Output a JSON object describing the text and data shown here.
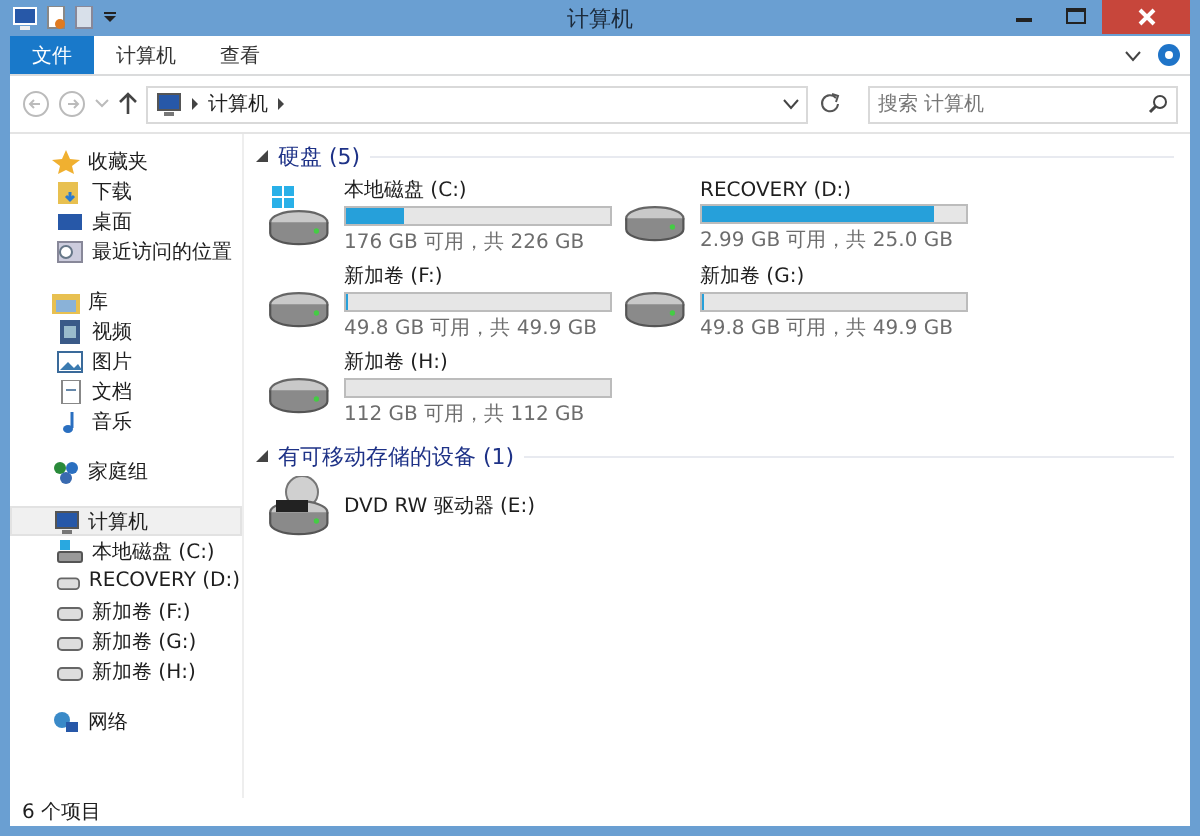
{
  "window": {
    "title": "计算机"
  },
  "ribbon": {
    "tabs": [
      {
        "label": "文件",
        "selected": true
      },
      {
        "label": "计算机",
        "selected": false
      },
      {
        "label": "查看",
        "selected": false
      }
    ]
  },
  "address": {
    "crumbs": [
      "计算机"
    ]
  },
  "search": {
    "placeholder": "搜索 计算机"
  },
  "sidebar": {
    "items": [
      {
        "label": "收藏夹",
        "kind": "star",
        "selected": false,
        "children": [
          {
            "label": "下载",
            "kind": "download",
            "selected": false
          },
          {
            "label": "桌面",
            "kind": "desktop",
            "selected": false
          },
          {
            "label": "最近访问的位置",
            "kind": "recent",
            "selected": false
          }
        ]
      },
      {
        "label": "库",
        "kind": "library",
        "selected": false,
        "children": [
          {
            "label": "视频",
            "kind": "video",
            "selected": false
          },
          {
            "label": "图片",
            "kind": "picture",
            "selected": false
          },
          {
            "label": "文档",
            "kind": "document",
            "selected": false
          },
          {
            "label": "音乐",
            "kind": "music",
            "selected": false
          }
        ]
      },
      {
        "label": "家庭组",
        "kind": "homegroup",
        "selected": false
      },
      {
        "label": "计算机",
        "kind": "computer",
        "selected": true,
        "children": [
          {
            "label": "本地磁盘 (C:)",
            "kind": "system",
            "selected": false
          },
          {
            "label": "RECOVERY (D:)",
            "kind": "drive",
            "selected": false
          },
          {
            "label": "新加卷 (F:)",
            "kind": "drive",
            "selected": false
          },
          {
            "label": "新加卷 (G:)",
            "kind": "drive",
            "selected": false
          },
          {
            "label": "新加卷 (H:)",
            "kind": "drive",
            "selected": false
          }
        ]
      },
      {
        "label": "网络",
        "kind": "network",
        "selected": false
      }
    ]
  },
  "groups": [
    {
      "title": "硬盘 (5)",
      "expanded": true,
      "items": [
        {
          "name": "本地磁盘 (C:)",
          "kind": "system",
          "level": 0.22,
          "reading": "176 GB 可用，共 226 GB"
        },
        {
          "name": "RECOVERY (D:)",
          "kind": "drive",
          "level": 0.88,
          "reading": "2.99 GB 可用，共 25.0 GB"
        },
        {
          "name": "新加卷 (F:)",
          "kind": "drive",
          "level": 0.002,
          "reading": "49.8 GB 可用，共 49.9 GB"
        },
        {
          "name": "新加卷 (G:)",
          "kind": "drive",
          "level": 0.002,
          "reading": "49.8 GB 可用，共 49.9 GB"
        },
        {
          "name": "新加卷 (H:)",
          "kind": "drive",
          "level": 0,
          "reading": "112 GB 可用，共 112 GB"
        }
      ]
    },
    {
      "title": "有可移动存储的设备 (1)",
      "expanded": true,
      "items": [
        {
          "name": "DVD RW 驱动器 (E:)",
          "kind": "dvd"
        }
      ]
    }
  ],
  "status_bar": {
    "text": "6 个项目"
  }
}
